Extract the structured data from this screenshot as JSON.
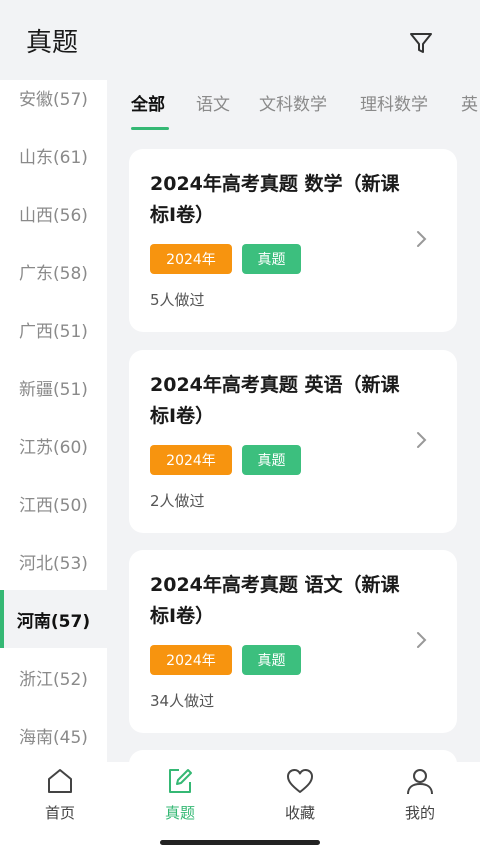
{
  "header": {
    "title": "真题",
    "filter_icon": "filter-icon"
  },
  "sidebar": {
    "items": [
      {
        "label": "安徽(57)",
        "active": false
      },
      {
        "label": "山东(61)",
        "active": false
      },
      {
        "label": "山西(56)",
        "active": false
      },
      {
        "label": "广东(58)",
        "active": false
      },
      {
        "label": "广西(51)",
        "active": false
      },
      {
        "label": "新疆(51)",
        "active": false
      },
      {
        "label": "江苏(60)",
        "active": false
      },
      {
        "label": "江西(50)",
        "active": false
      },
      {
        "label": "河北(53)",
        "active": false
      },
      {
        "label": "河南(57)",
        "active": true
      },
      {
        "label": "浙江(52)",
        "active": false
      },
      {
        "label": "海南(45)",
        "active": false
      }
    ]
  },
  "tabs": [
    {
      "label": "全部",
      "active": true
    },
    {
      "label": "语文",
      "active": false
    },
    {
      "label": "文科数学",
      "active": false
    },
    {
      "label": "理科数学",
      "active": false
    },
    {
      "label": "英",
      "active": false
    }
  ],
  "cards": [
    {
      "title": "2024年高考真题 数学（新课标I卷）",
      "year_tag": "2024年",
      "type_tag": "真题",
      "count": "5人做过"
    },
    {
      "title": "2024年高考真题 英语（新课标I卷）",
      "year_tag": "2024年",
      "type_tag": "真题",
      "count": "2人做过"
    },
    {
      "title": "2024年高考真题 语文（新课标I卷）",
      "year_tag": "2024年",
      "type_tag": "真题",
      "count": "34人做过"
    }
  ],
  "bottom_nav": [
    {
      "label": "首页",
      "icon": "home-icon",
      "active": false
    },
    {
      "label": "真题",
      "icon": "edit-icon",
      "active": true
    },
    {
      "label": "收藏",
      "icon": "heart-icon",
      "active": false
    },
    {
      "label": "我的",
      "icon": "user-icon",
      "active": false
    }
  ],
  "colors": {
    "accent": "#35b874",
    "year_tag": "#f7940f",
    "type_tag": "#3cbf7e",
    "background": "#f2f3f5"
  }
}
